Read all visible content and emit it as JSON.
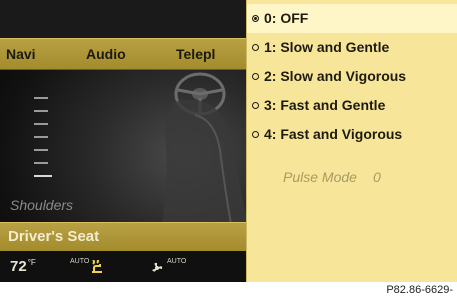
{
  "nav": {
    "items": [
      "Navi",
      "Audio",
      "Telepl"
    ]
  },
  "left_panel": {
    "region_label": "Shoulders",
    "seat_label": "Driver's Seat",
    "temperature": "72",
    "temperature_unit": "°F",
    "auto_left": "AUTO",
    "auto_right": "AUTO",
    "level_ticks": 7
  },
  "massage_menu": {
    "options": [
      {
        "label": "0: OFF",
        "selected": true
      },
      {
        "label": "1: Slow and Gentle",
        "selected": false
      },
      {
        "label": "2: Slow and Vigorous",
        "selected": false
      },
      {
        "label": "3: Fast and Gentle",
        "selected": false
      },
      {
        "label": "4: Fast and Vigorous",
        "selected": false
      }
    ],
    "pulse_label": "Pulse Mode",
    "pulse_value": "0"
  },
  "caption": "P82.86-6629-",
  "icons": [
    "steering-wheel-icon",
    "seat-heat-icon",
    "fan-icon",
    "radio-selected-icon",
    "radio-unselected-icon"
  ],
  "colors": {
    "accent_bar": "#a38c2c",
    "menu_bg": "#f7e69a",
    "menu_selected": "#fff6c8",
    "text_dark": "#1e1b0e"
  }
}
